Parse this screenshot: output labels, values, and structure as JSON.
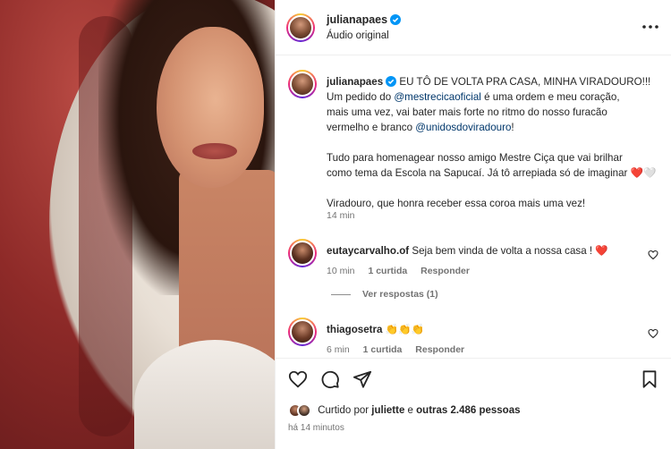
{
  "header": {
    "username": "julianapaes",
    "subtitle": "Áudio original",
    "more_icon": "more-horizontal-icon"
  },
  "caption": {
    "username": "julianapaes",
    "line1_pre": " EU TÔ DE VOLTA PRA CASA, MINHA VIRADOURO!!!",
    "line2_pre": "Um pedido do ",
    "mention1": "@mestrecicaoficial",
    "line2_post": " é uma ordem e meu coração,",
    "line3": "mais uma vez, vai bater mais forte no ritmo do nosso furacão",
    "line4_pre": "vermelho e branco ",
    "mention2": "@unidosdoviradouro",
    "line4_post": "!",
    "para2_line1": "Tudo para homenagear nosso amigo Mestre Ciça que vai brilhar",
    "para2_line2": "como tema da Escola na Sapucaí. Já tô arrepiada só de imaginar ❤️🤍",
    "para3": "Viradouro, que honra receber essa coroa mais uma vez!",
    "time": "14 min"
  },
  "comments": [
    {
      "username": "eutaycarvalho.of",
      "text": " Seja bem vinda de volta a nossa casa ! ❤️",
      "time": "10 min",
      "likes": "1 curtida",
      "reply": "Responder"
    },
    {
      "username": "thiagosetra",
      "text": " 👏👏👏",
      "time": "6 min",
      "likes": "1 curtida",
      "reply": "Responder"
    }
  ],
  "view_replies": "Ver respostas (1)",
  "actions": {
    "like_icon": "heart-icon",
    "comment_icon": "comment-icon",
    "share_icon": "send-icon",
    "save_icon": "bookmark-icon"
  },
  "likes": {
    "prefix": "Curtido por ",
    "user": "juliette",
    "middle": " e ",
    "others": "outras 2.486 pessoas"
  },
  "posted_ago": "há 14 minutos",
  "colors": {
    "link": "#00376b",
    "verified": "#0095f6",
    "muted": "#737373"
  }
}
